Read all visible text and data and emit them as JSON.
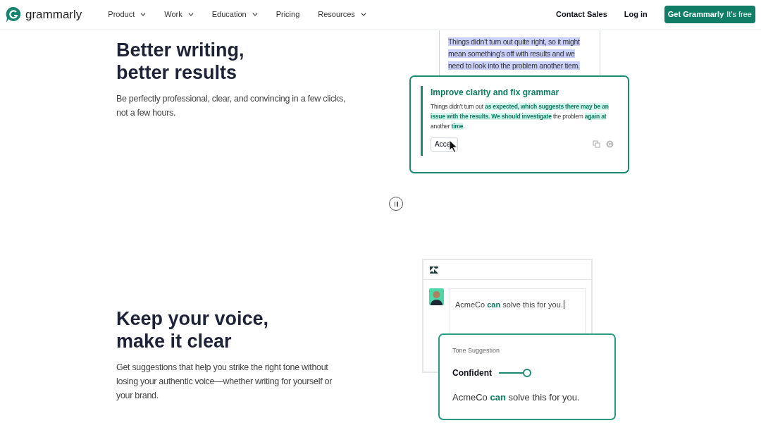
{
  "nav": {
    "logo": "grammarly",
    "menu": [
      {
        "label": "Product",
        "dropdown": true
      },
      {
        "label": "Work",
        "dropdown": true
      },
      {
        "label": "Education",
        "dropdown": true
      },
      {
        "label": "Pricing",
        "dropdown": false
      },
      {
        "label": "Resources",
        "dropdown": true
      }
    ],
    "links": [
      "Contact Sales",
      "Log in"
    ],
    "cta": {
      "label": "Get Grammarly",
      "note": "It's free"
    }
  },
  "section1": {
    "title_lines": [
      "Better writing,",
      "better results"
    ],
    "body": "Be perfectly professional, clear, and convincing in a few clicks, not a few hours.",
    "original_text": "Things didn’t turn out quite right, so it might mean something’s off with results and we need to look into the problem another tiem.",
    "suggestion": {
      "title": "Improve clarity and fix grammar",
      "segments": [
        {
          "text": "Things didn’t turn out ",
          "highlight": false
        },
        {
          "text": "as expected, which suggests there may be an issue with the results. We should investigate",
          "highlight": true
        },
        {
          "text": " the problem ",
          "highlight": false
        },
        {
          "text": "again at",
          "highlight": true
        },
        {
          "text": " another ",
          "highlight": false
        },
        {
          "text": "time",
          "highlight": true
        },
        {
          "text": ".",
          "highlight": false
        }
      ],
      "accept": "Acce"
    }
  },
  "section2": {
    "title_lines": [
      "Keep your voice,",
      "make it clear"
    ],
    "body": "Get suggestions that help you strike the right tone without losing your authentic voice—whether writing for yourself or your brand.",
    "editor_text": "AcmeCo **can** solve this for you.",
    "tone": {
      "label": "Tone Suggestion",
      "tone": "Confident",
      "level": 1,
      "text": "AcmeCo **can** solve this for you."
    }
  }
}
